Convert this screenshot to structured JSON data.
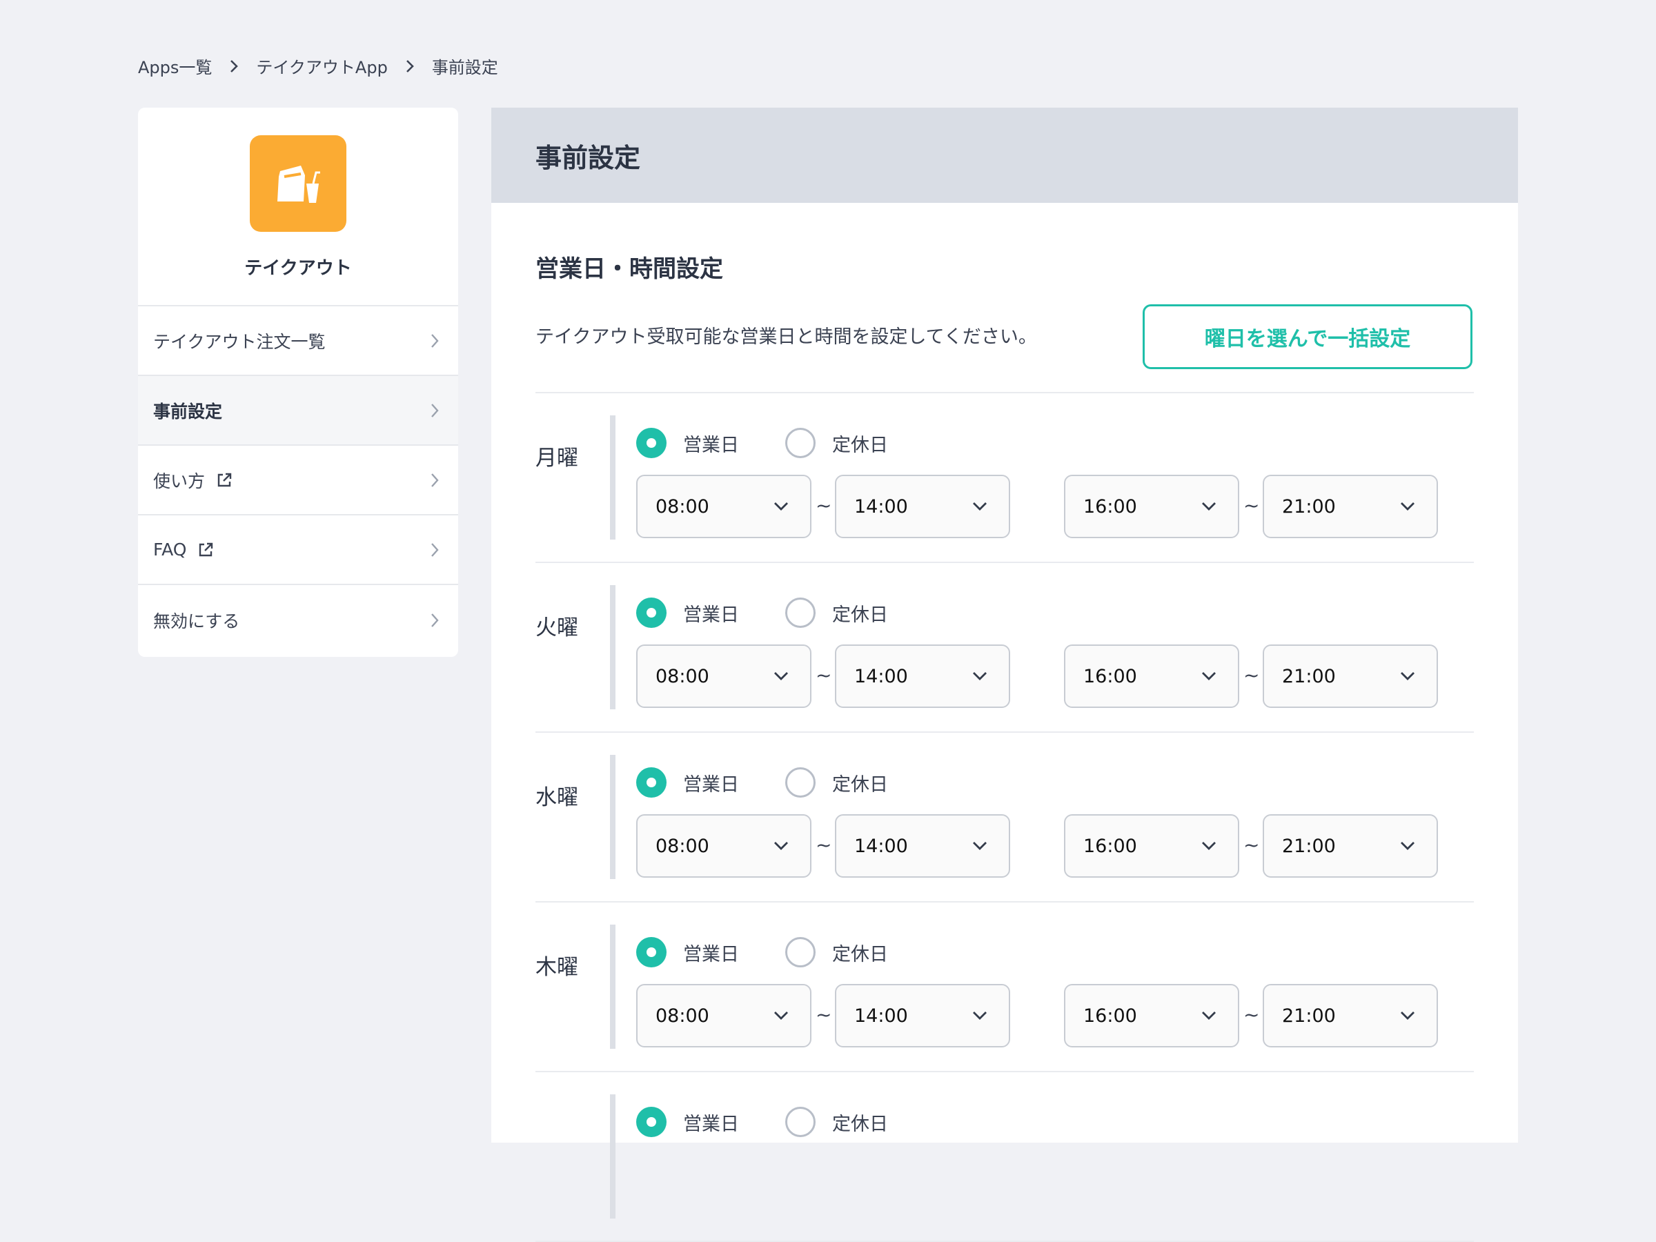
{
  "breadcrumb": [
    "Apps一覧",
    "テイクアウトApp",
    "事前設定"
  ],
  "sidebar": {
    "app_name": "テイクアウト",
    "items": [
      {
        "label": "テイクアウト注文一覧",
        "external": false,
        "active": false
      },
      {
        "label": "事前設定",
        "external": false,
        "active": true
      },
      {
        "label": "使い方",
        "external": true,
        "active": false
      },
      {
        "label": "FAQ",
        "external": true,
        "active": false
      },
      {
        "label": "無効にする",
        "external": false,
        "active": false
      }
    ]
  },
  "main": {
    "header_title": "事前設定",
    "section_title": "営業日・時間設定",
    "description": "テイクアウト受取可能な営業日と時間を設定してください。",
    "bulk_button": "曜日を選んで一括設定",
    "open_label": "営業日",
    "closed_label": "定休日",
    "tilde": "~",
    "days": [
      {
        "name": "月曜",
        "status": "open",
        "times": [
          "08:00",
          "14:00",
          "16:00",
          "21:00"
        ]
      },
      {
        "name": "火曜",
        "status": "open",
        "times": [
          "08:00",
          "14:00",
          "16:00",
          "21:00"
        ]
      },
      {
        "name": "水曜",
        "status": "open",
        "times": [
          "08:00",
          "14:00",
          "16:00",
          "21:00"
        ]
      },
      {
        "name": "木曜",
        "status": "open",
        "times": [
          "08:00",
          "14:00",
          "16:00",
          "21:00"
        ]
      },
      {
        "name": "",
        "status": "open",
        "times": []
      }
    ]
  },
  "colors": {
    "accent": "#1fbfa9",
    "app_icon": "#fbab33",
    "background": "#f0f1f5",
    "header_bg": "#d9dde5"
  },
  "icons": {
    "app": "takeout-bag-drink-icon",
    "chevron": "chevron-right-icon",
    "external": "external-link-icon",
    "dropdown": "chevron-down-icon"
  }
}
